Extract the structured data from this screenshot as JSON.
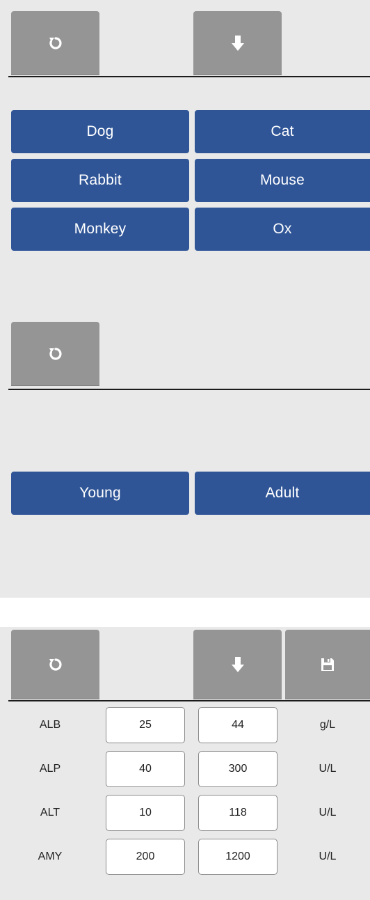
{
  "species_section": {
    "buttons": [
      "Dog",
      "Cat",
      "Rabbit",
      "Mouse",
      "Monkey",
      "Ox"
    ]
  },
  "age_section": {
    "buttons": [
      "Young",
      "Adult"
    ]
  },
  "reference_table": {
    "rows": [
      {
        "analyte": "ALB",
        "low": "25",
        "high": "44",
        "unit": "g/L"
      },
      {
        "analyte": "ALP",
        "low": "40",
        "high": "300",
        "unit": "U/L"
      },
      {
        "analyte": "ALT",
        "low": "10",
        "high": "118",
        "unit": "U/L"
      },
      {
        "analyte": "AMY",
        "low": "200",
        "high": "1200",
        "unit": "U/L"
      }
    ]
  },
  "icons": {
    "reset": "reset-icon",
    "download": "download-icon",
    "save": "save-icon"
  },
  "colors": {
    "panel_bg": "#e9e9e9",
    "toolbar_button": "#959595",
    "choice_button": "#2f5597",
    "divider": "#1b1b1b"
  }
}
